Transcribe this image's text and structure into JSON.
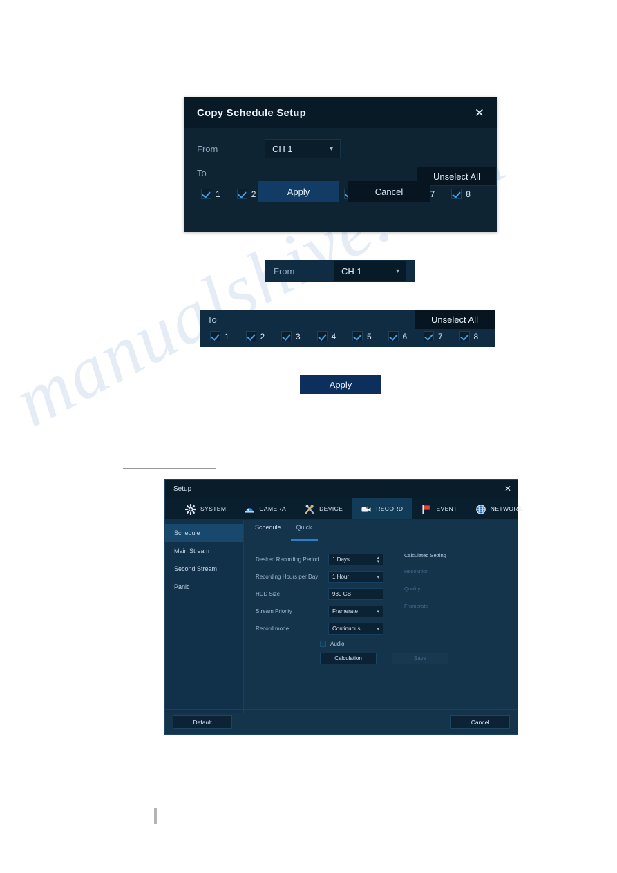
{
  "watermark": {
    "text": "manualshive.com"
  },
  "copy_dialog": {
    "title": "Copy Schedule Setup",
    "close_icon": "close-icon",
    "from_label": "From",
    "from_value": "CH 1",
    "to_label": "To",
    "unselect_all_label": "Unselect All",
    "channels": [
      {
        "num": "1",
        "checked": true
      },
      {
        "num": "2",
        "checked": true
      },
      {
        "num": "3",
        "checked": true
      },
      {
        "num": "4",
        "checked": true
      },
      {
        "num": "5",
        "checked": true
      },
      {
        "num": "6",
        "checked": true
      },
      {
        "num": "7",
        "checked": true
      },
      {
        "num": "8",
        "checked": true
      }
    ],
    "apply_label": "Apply",
    "cancel_label": "Cancel"
  },
  "from_callout": {
    "label": "From",
    "value": "CH 1"
  },
  "to_callout": {
    "label": "To",
    "unselect_all_label": "Unselect All",
    "channels": [
      {
        "num": "1"
      },
      {
        "num": "2"
      },
      {
        "num": "3"
      },
      {
        "num": "4"
      },
      {
        "num": "5"
      },
      {
        "num": "6"
      },
      {
        "num": "7"
      },
      {
        "num": "8"
      }
    ]
  },
  "apply_callout": {
    "label": "Apply"
  },
  "setup_dialog": {
    "title": "Setup",
    "close_icon": "close-icon",
    "tabs": [
      {
        "label": "SYSTEM",
        "icon": "gear-icon",
        "active": false
      },
      {
        "label": "CAMERA",
        "icon": "dome-camera-icon",
        "active": false
      },
      {
        "label": "DEVICE",
        "icon": "tools-icon",
        "active": false
      },
      {
        "label": "RECORD",
        "icon": "camcorder-icon",
        "active": true
      },
      {
        "label": "EVENT",
        "icon": "flag-icon",
        "active": false
      },
      {
        "label": "NETWORK",
        "icon": "globe-icon",
        "active": false
      }
    ],
    "sidebar": [
      {
        "label": "Schedule",
        "active": true
      },
      {
        "label": "Main Stream",
        "active": false
      },
      {
        "label": "Second Stream",
        "active": false
      },
      {
        "label": "Panic",
        "active": false
      }
    ],
    "sub_tabs": [
      {
        "label": "Schedule",
        "active": false
      },
      {
        "label": "Quick",
        "active": true
      }
    ],
    "form": [
      {
        "label": "Desired Recording Period",
        "value": "1 Days",
        "control": "spinner"
      },
      {
        "label": "Recording Hours per Day",
        "value": "1 Hour",
        "control": "dropdown"
      },
      {
        "label": "HDD Size",
        "value": "930 GB",
        "control": "readonly"
      },
      {
        "label": "Stream Priority",
        "value": "Framerate",
        "control": "dropdown"
      },
      {
        "label": "Record mode",
        "value": "Continuous",
        "control": "dropdown"
      }
    ],
    "calculated": {
      "title": "Calculated Setting",
      "rows": [
        "Resolution",
        "Quality",
        "Framerate"
      ]
    },
    "audio_label": "Audio",
    "audio_checked": false,
    "calculation_label": "Calculation",
    "save_label": "Save",
    "default_label": "Default",
    "cancel_label": "Cancel"
  }
}
